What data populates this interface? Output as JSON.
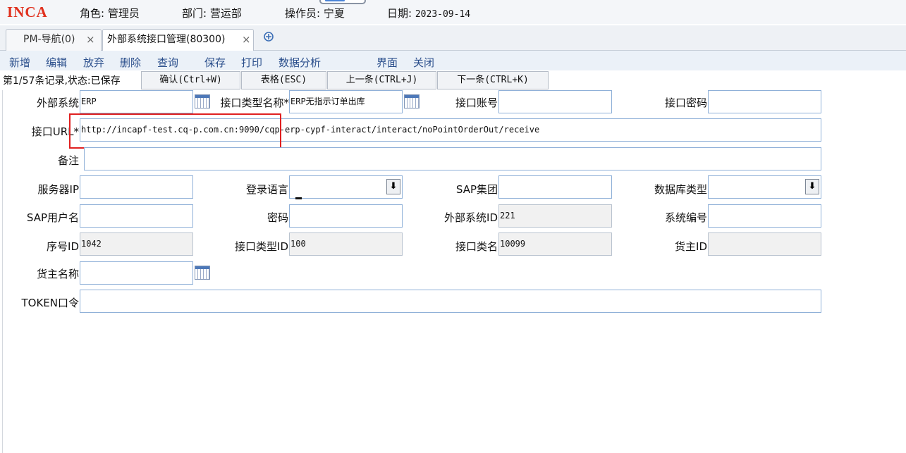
{
  "header": {
    "logo": "INCA",
    "role_label": "角色:",
    "role_value": "管理员",
    "dept_label": "部门:",
    "dept_value": "营运部",
    "operator_label": "操作员:",
    "operator_value": "宁夏",
    "date_label": "日期:",
    "date_value": "2023-09-14"
  },
  "tabs": [
    {
      "label": "PM-导航(0)",
      "close": "×"
    },
    {
      "label": "外部系统接口管理(80300)",
      "close": "×"
    }
  ],
  "tab_add_icon": "plus-circle-icon",
  "toolbar": {
    "new": "新增",
    "edit": "编辑",
    "discard": "放弃",
    "delete": "删除",
    "query": "查询",
    "save": "保存",
    "print": "打印",
    "analysis": "数据分析",
    "ui": "界面",
    "close": "关闭"
  },
  "status": {
    "text": "第1/57条记录,状态:已保存",
    "confirm": "确认(Ctrl+W)",
    "table": "表格(ESC)",
    "prev": "上一条(CTRL+J)",
    "next": "下一条(CTRL+K)"
  },
  "form": {
    "ext_system": {
      "label": "外部系统",
      "value": "ERP"
    },
    "if_type_name": {
      "label": "接口类型名称*",
      "value": "ERP无指示订单出库"
    },
    "if_account": {
      "label": "接口账号",
      "value": ""
    },
    "if_password": {
      "label": "接口密码",
      "value": ""
    },
    "if_url": {
      "label": "接口URL*",
      "value": "http://incapf-test.cq-p.com.cn:9090/cqp-erp-cypf-interact/interact/noPointOrderOut/receive"
    },
    "remark": {
      "label": "备注",
      "value": ""
    },
    "server_ip": {
      "label": "服务器IP",
      "value": ""
    },
    "login_lang": {
      "label": "登录语言",
      "value": ""
    },
    "sap_group": {
      "label": "SAP集团",
      "value": ""
    },
    "db_type": {
      "label": "数据库类型",
      "value": ""
    },
    "sap_user": {
      "label": "SAP用户名",
      "value": ""
    },
    "password": {
      "label": "密码",
      "value": ""
    },
    "ext_system_id": {
      "label": "外部系统ID",
      "value": "221"
    },
    "system_code": {
      "label": "系统编号",
      "value": ""
    },
    "seq_id": {
      "label": "序号ID",
      "value": "1042"
    },
    "if_type_id": {
      "label": "接口类型ID",
      "value": "100"
    },
    "if_class_name": {
      "label": "接口类名",
      "value": "10099"
    },
    "owner_id": {
      "label": "货主ID",
      "value": ""
    },
    "owner_name": {
      "label": "货主名称",
      "value": ""
    },
    "token": {
      "label": "TOKEN口令",
      "value": ""
    }
  },
  "colors": {
    "highlight_box": "#e02020",
    "logo": "#e0301e",
    "toolbar_text": "#2b4f8c"
  }
}
